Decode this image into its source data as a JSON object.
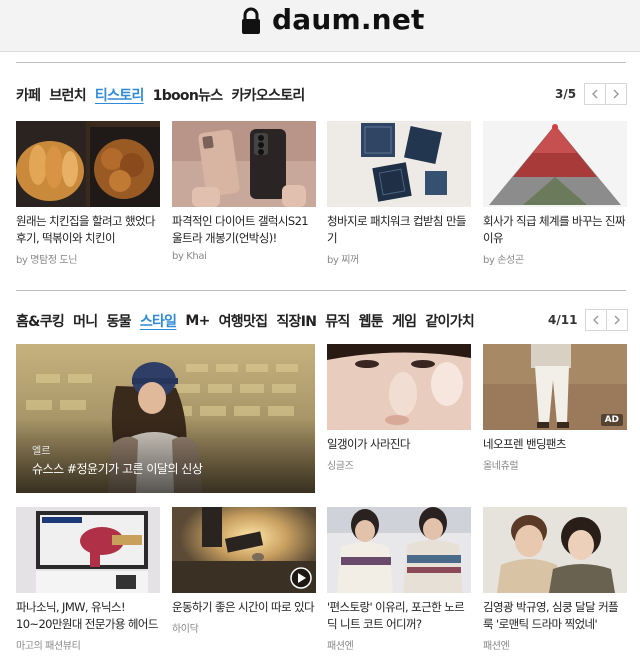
{
  "browser": {
    "url": "daum.net"
  },
  "section1": {
    "tabs": [
      "카페",
      "브런치",
      "티스토리",
      "1boon뉴스",
      "카카오스토리"
    ],
    "active_tab": 2,
    "pager": "3/5",
    "cards": [
      {
        "title": "원래는 치킨집을 할려고 했었다 후기, 떡볶이와 치킨이",
        "source": "by 명탐정 도닌",
        "image": "fried-food-photo"
      },
      {
        "title": "파격적인 다이어트 갤럭시S21 울트라 개봉기(언박싱)!",
        "source": "by Khai",
        "image": "smartphones-photo"
      },
      {
        "title": "청바지로 패치워크 컵받침 만들기",
        "source": "by 찌꺼",
        "image": "denim-coasters-photo"
      },
      {
        "title": "회사가 직급 체계를 바꾸는 진짜 이유",
        "source": "by 손성곤",
        "image": "people-pyramid-photo"
      }
    ]
  },
  "section2": {
    "tabs": [
      "홈&쿠킹",
      "머니",
      "동물",
      "스타일",
      "M+",
      "여행맛집",
      "직장IN",
      "뮤직",
      "웹툰",
      "게임",
      "같이가치"
    ],
    "active_tab": 3,
    "pager": "4/11",
    "feature": {
      "source": "엘르",
      "title": "슈스스 #정윤기가 고른 이달의 신상",
      "image": "woman-in-stadium-photo"
    },
    "cards": [
      {
        "title": "일갱이가 사라진다",
        "source": "싱글즈",
        "image": "face-closeup-photo"
      },
      {
        "title": "네오프렌 밴딩팬츠",
        "source": "올네츄럴",
        "image": "white-pants-photo",
        "badge": "AD"
      },
      {
        "title": "파나소닉, JMW, 유닉스! 10~20만원대 전문가용 헤어드",
        "source": "마고의 패션뷰티",
        "image": "hair-dryer-photo"
      },
      {
        "title": "운동하기 좋은 시간이 따로 있다",
        "source": "하이닥",
        "image": "sunset-runner-photo",
        "video": true
      },
      {
        "title": "'편스토랑' 이유리, 포근한 노르딕 니트 코트 어디꺼?",
        "source": "패션엔",
        "image": "nordic-knit-photo"
      },
      {
        "title": "김영광 박규영, 심쿵 달달 커플룩 '로맨틱 드라마 찍었네'",
        "source": "패션엔",
        "image": "couple-portrait-photo"
      }
    ]
  }
}
